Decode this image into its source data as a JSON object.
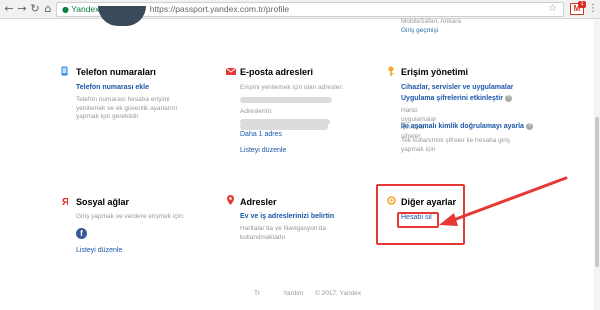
{
  "browser": {
    "back_glyph": "←",
    "forward_glyph": "→",
    "reload_glyph": "↻",
    "home_glyph": "⌂",
    "lock_glyph": "🔒",
    "ev_label": "Yandex LLC [RU]",
    "separator": "|",
    "url": "https://passport.yandex.com.tr/profile",
    "star_glyph": "☆",
    "gmail_glyph": "M",
    "gmail_badge": "1",
    "menu_glyph": "⋮"
  },
  "session": {
    "location": "MobileSafari, Ankara",
    "history_link": "Giriş geçmişi"
  },
  "phone": {
    "icon": "phone-icon",
    "title": "Telefon numaraları",
    "add_link": "Telefon numarası ekle",
    "desc": "Telefon numarası hesaba erişimi yenilemek ve ek güvenlik ayarlarını yapmak için gereklidir"
  },
  "email": {
    "icon": "envelope-icon",
    "title": "E-posta adresleri",
    "desc": "Erişimi yenilemek için olan adresler:",
    "extra_label": "Adreslerim:",
    "more_link": "Daha 1 adres",
    "edit_link": "Listeyi düzenle"
  },
  "access": {
    "icon": "key-icon",
    "title": "Erişim yönetimi",
    "devices_link": "Cihazlar, servisler ve uygulamalar",
    "app_passwords_link": "Uygulama şifrelerini etkinleştir",
    "app_passwords_desc": "Harici uygulamalar için özel şifreler",
    "two_factor_link": "İki aşamalı kimlik doğrulamayı ayarla",
    "two_factor_desc": "Tek kullanımlık şifreler ile hesaba giriş yapmak için"
  },
  "social": {
    "icon": "yandex-y-icon",
    "title": "Sosyal ağlar",
    "desc": "Giriş yapmak ve verdere erişmek için:",
    "facebook_glyph": "f",
    "edit_link": "Listeyi düzenle"
  },
  "addresses": {
    "icon": "location-pin-icon",
    "title": "Adresler",
    "link": "Ev ve iş adreslerinizi belirtin",
    "desc": "Haritalar'da ve Navigasyon'da kullanılmaktadır"
  },
  "other": {
    "icon": "settings-icon",
    "title": "Diğer ayarlar",
    "delete_link": "Hesabı sil"
  },
  "footer": {
    "lang": "Tr",
    "help": "Yardım",
    "copyright": "© 2017, Yandex"
  },
  "colors": {
    "link": "#1a57a8",
    "annotation": "#e53935",
    "accent_yellow": "#f5a623",
    "yandex_red": "#e52620"
  }
}
